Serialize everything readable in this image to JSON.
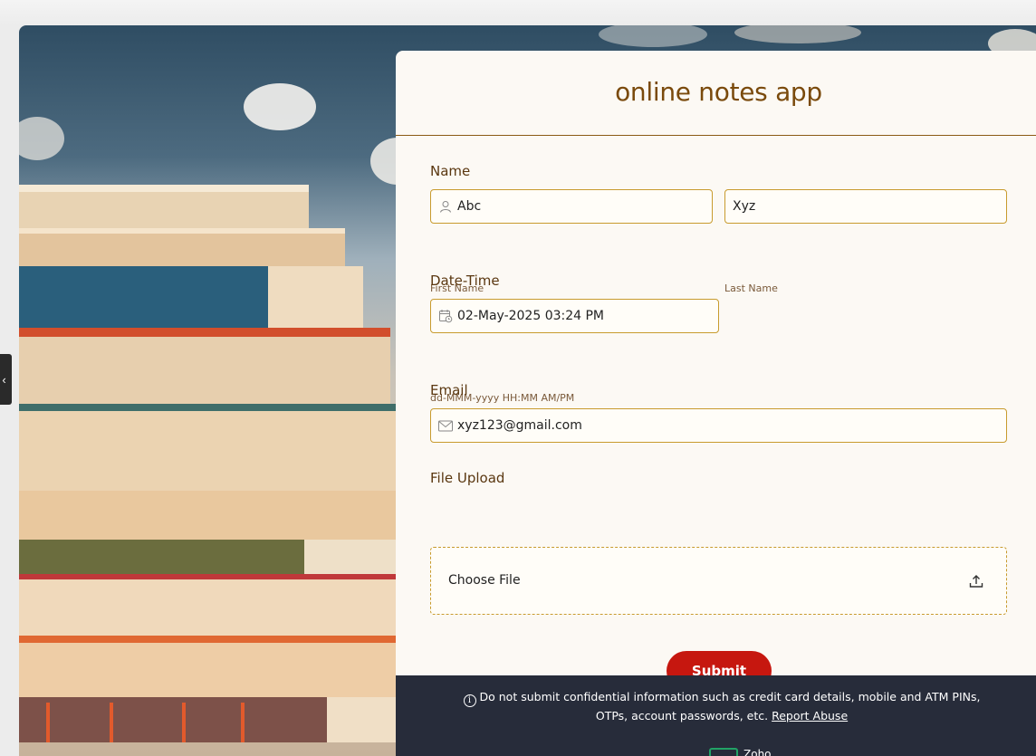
{
  "form": {
    "title": "online notes app",
    "name": {
      "label": "Name",
      "first_value": "Abc",
      "first_hint": "First Name",
      "last_value": "Xyz",
      "last_hint": "Last Name"
    },
    "datetime": {
      "label": "Date-Time",
      "value": "02-May-2025 03:24 PM",
      "hint": "dd-MMM-yyyy HH:MM AM/PM"
    },
    "email": {
      "label": "Email",
      "value": "xyz123@gmail.com"
    },
    "upload": {
      "label": "File Upload",
      "button_label": "Choose File"
    },
    "submit_label": "Submit"
  },
  "footer": {
    "notice": "Do not submit confidential information such as credit card details, mobile and ATM PINs, OTPs, account passwords, etc.",
    "report_link": "Report Abuse",
    "brand": "Zoho"
  },
  "icons": {
    "name_icon": "user-icon",
    "datetime_icon": "calendar-clock-icon",
    "email_icon": "mail-icon",
    "upload_icon": "upload-icon",
    "info_icon": "info-icon",
    "collapse_icon": "chevron-left-icon"
  },
  "colors": {
    "accent": "#c6170f",
    "title": "#7a4a0c",
    "field_border": "#c89b2e",
    "card_bg": "#fcf9f4",
    "footer_bg": "#272c3a"
  }
}
